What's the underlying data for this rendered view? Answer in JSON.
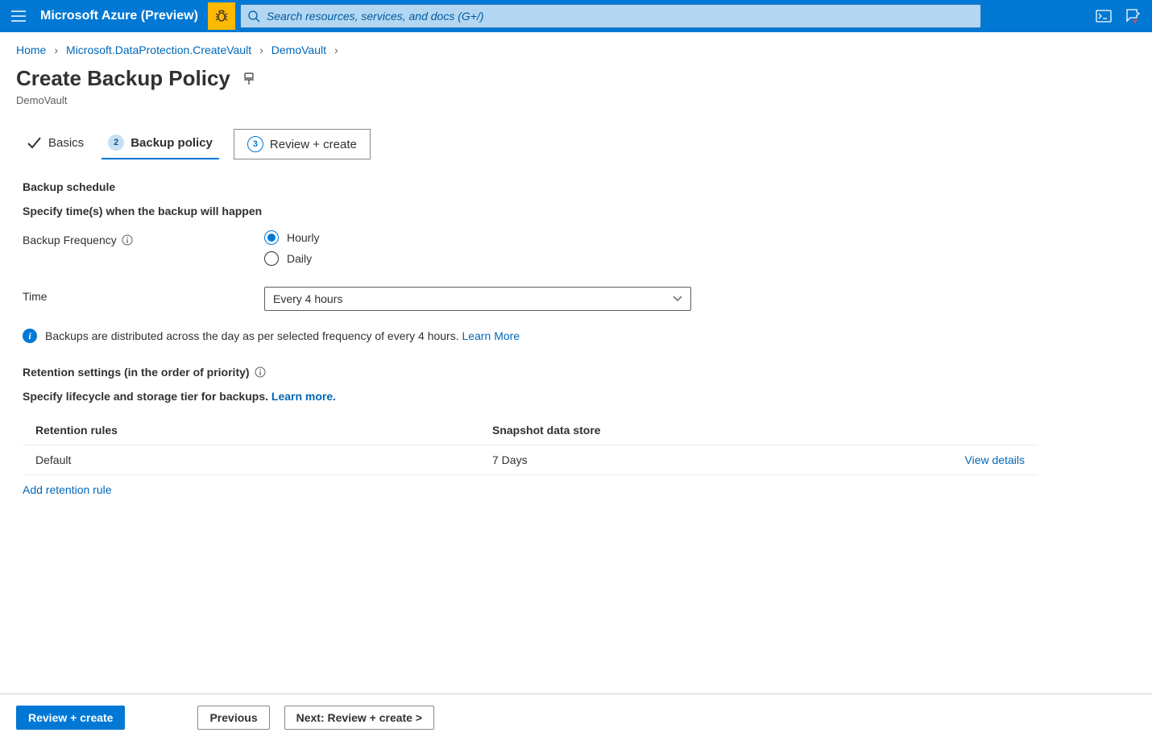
{
  "topbar": {
    "brand": "Microsoft Azure (Preview)",
    "search_placeholder": "Search resources, services, and docs (G+/)"
  },
  "breadcrumb": {
    "items": [
      "Home",
      "Microsoft.DataProtection.CreateVault",
      "DemoVault"
    ]
  },
  "page": {
    "title": "Create Backup Policy",
    "subtitle": "DemoVault"
  },
  "tabs": {
    "basics": "Basics",
    "backup_policy": "Backup policy",
    "review": "Review + create",
    "step2": "2",
    "step3": "3"
  },
  "schedule": {
    "heading": "Backup schedule",
    "sub": "Specify time(s) when the backup will happen",
    "freq_label": "Backup Frequency",
    "hourly": "Hourly",
    "daily": "Daily",
    "time_label": "Time",
    "time_value": "Every 4 hours",
    "info_text": "Backups are distributed across the day as per selected frequency of every 4 hours.",
    "learn_more": "Learn More"
  },
  "retention": {
    "heading": "Retention settings (in the order of priority)",
    "sub_plain": "Specify lifecycle and storage tier for backups.",
    "learn_more": "Learn more.",
    "col_rules": "Retention rules",
    "col_store": "Snapshot data store",
    "row_name": "Default",
    "row_value": "7 Days",
    "view_details": "View details",
    "add_rule": "Add retention rule"
  },
  "footer": {
    "review_create": "Review + create",
    "previous": "Previous",
    "next": "Next: Review + create >"
  }
}
